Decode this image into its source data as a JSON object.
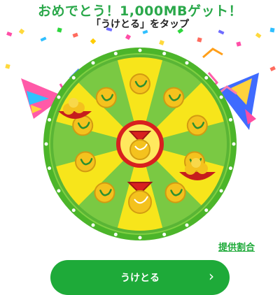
{
  "header": {
    "title": "おめでとう！1,000MBゲット！",
    "instruction": "「うけとる」をタップ"
  },
  "wheel": {
    "prize_icon": "v-coin-icon",
    "center_icon": "medal-icon",
    "segments": 12
  },
  "links": {
    "provide_ratio": "提供割合"
  },
  "cta": {
    "label": "うけとる",
    "arrow": "›"
  },
  "colors": {
    "accent_green": "#1eaa39",
    "title_green": "#2aa84a",
    "wheel_green": "#4cb52a",
    "wheel_yellow": "#f7e51b",
    "rim_red": "#d8201f",
    "gold": "#f4c21e"
  }
}
